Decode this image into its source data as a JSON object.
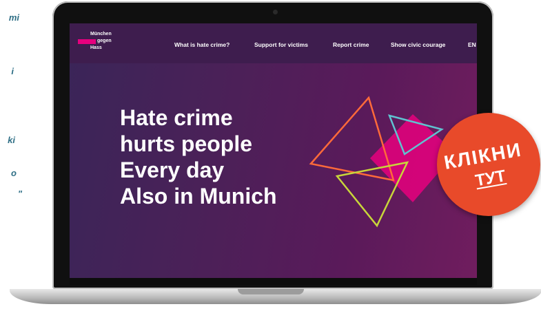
{
  "side_text": {
    "lines": [
      "mi",
      "i",
      "ki",
      "o",
      "\""
    ]
  },
  "logo": {
    "line1": "München",
    "line2": "gegen",
    "line3": "Hass"
  },
  "nav": {
    "items": [
      "What is hate crime?",
      "Support for victims",
      "Report crime",
      "Show civic courage",
      "EN"
    ]
  },
  "hero": {
    "lines": [
      "Hate crime",
      "hurts people",
      "Every day",
      "Also in Munich"
    ]
  },
  "badge": {
    "line1": "КЛІКНИ",
    "line2": "ТУТ",
    "color": "#e84a2a"
  },
  "colors": {
    "accent": "#e6007e",
    "nav_bg": "#3e1d4e",
    "triangle_orange": "#ff6a3a",
    "triangle_teal": "#5fc3d0",
    "triangle_lime": "#c8d63a"
  }
}
